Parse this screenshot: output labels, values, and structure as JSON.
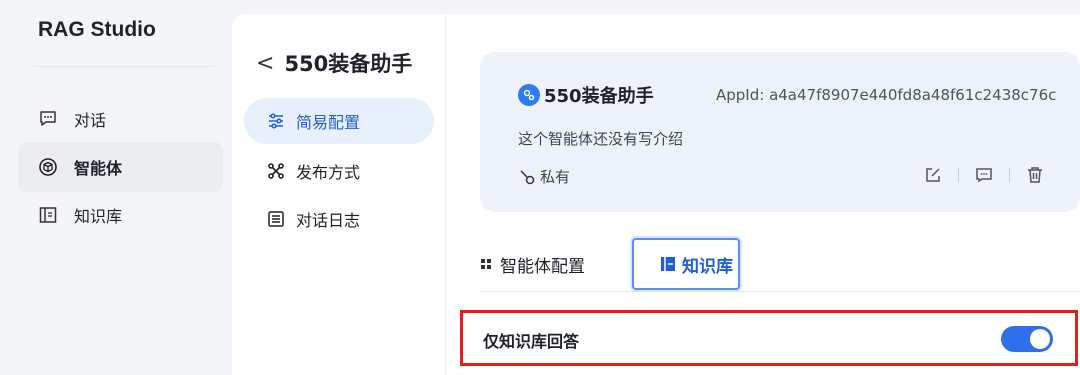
{
  "app": {
    "brand": "RAG Studio"
  },
  "sidebar": {
    "items": [
      {
        "label": "对话",
        "icon": "chat-bubble-icon",
        "active": false
      },
      {
        "label": "智能体",
        "icon": "cube-icon",
        "active": true
      },
      {
        "label": "知识库",
        "icon": "book-icon",
        "active": false
      }
    ]
  },
  "subnav": {
    "back_title": "550装备助手",
    "items": [
      {
        "label": "简易配置",
        "icon": "sliders-icon",
        "active": true
      },
      {
        "label": "发布方式",
        "icon": "share-nodes-icon",
        "active": false
      },
      {
        "label": "对话日志",
        "icon": "list-log-icon",
        "active": false
      }
    ]
  },
  "card": {
    "name": "550装备助手",
    "appid": "AppId: a4a47f8907e440fd8a48f61c2438c76c",
    "description": "这个智能体还没有写介绍",
    "visibility": "私有",
    "actions": [
      "edit-icon",
      "chat-icon",
      "trash-icon"
    ]
  },
  "tabs": [
    {
      "label": "智能体配置",
      "icon": "grid-dots-icon",
      "active": false
    },
    {
      "label": "知识库",
      "icon": "kb-icon",
      "active": true
    }
  ],
  "kb_only": {
    "label": "仅知识库回答",
    "enabled": true
  },
  "colors": {
    "accent": "#2f6fec",
    "highlight_border": "#e0201b",
    "active_bg": "#e8f0fe"
  }
}
